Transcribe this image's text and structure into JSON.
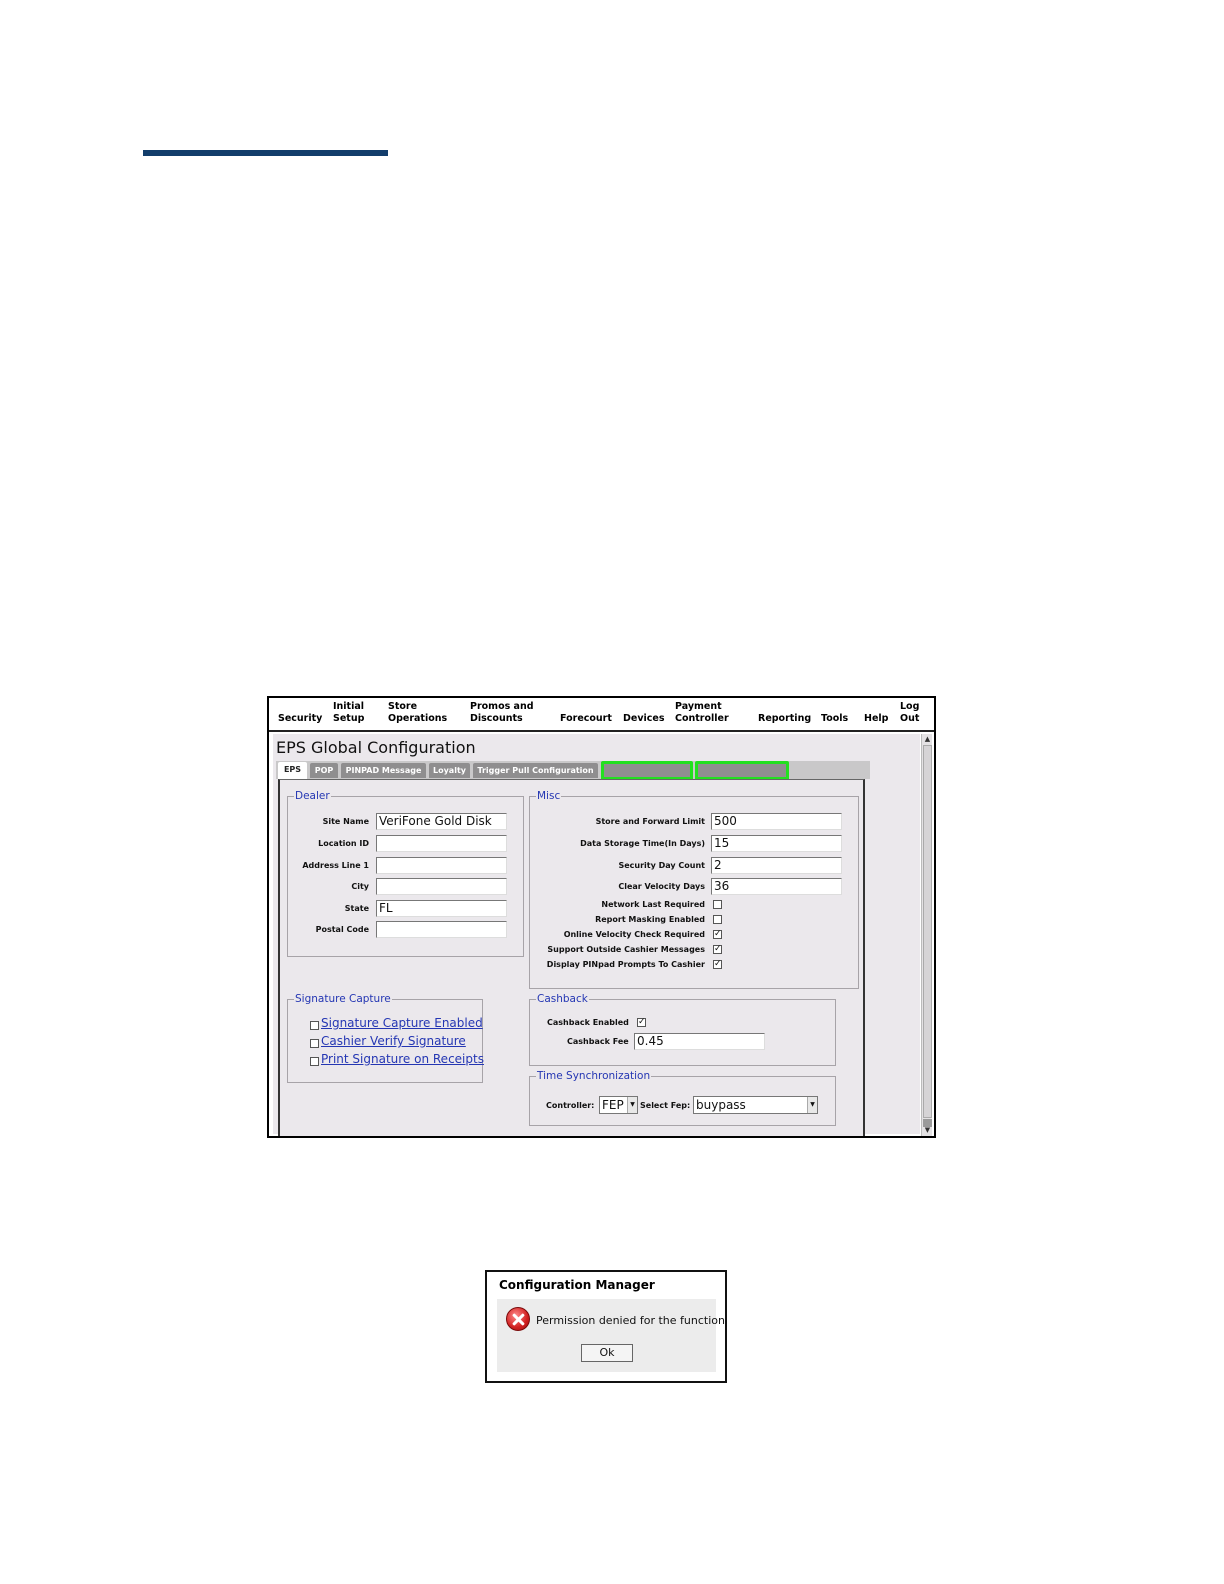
{
  "menu": [
    {
      "label": "Security"
    },
    {
      "label": "Initial\nSetup"
    },
    {
      "label": "Store\nOperations"
    },
    {
      "label": "Promos and\nDiscounts"
    },
    {
      "label": "Forecourt"
    },
    {
      "label": "Devices"
    },
    {
      "label": "Payment\nController"
    },
    {
      "label": "Reporting"
    },
    {
      "label": "Tools"
    },
    {
      "label": "Help"
    },
    {
      "label": "Log\nOut"
    }
  ],
  "page_title": "EPS Global Configuration",
  "tabs": [
    {
      "label": "EPS",
      "active": true
    },
    {
      "label": "POP"
    },
    {
      "label": "PINPAD Message"
    },
    {
      "label": "Loyalty"
    },
    {
      "label": "Trigger Pull Configuration"
    },
    {
      "label": "",
      "highlighted": true
    },
    {
      "label": "",
      "highlighted": true
    }
  ],
  "highlight_color": "#22e01f",
  "dealer": {
    "legend": "Dealer",
    "fields": [
      {
        "label": "Site Name",
        "value": "VeriFone Gold Disk"
      },
      {
        "label": "Location ID",
        "value": ""
      },
      {
        "label": "Address Line 1",
        "value": ""
      },
      {
        "label": "City",
        "value": ""
      },
      {
        "label": "State",
        "value": "FL"
      },
      {
        "label": "Postal Code",
        "value": ""
      }
    ]
  },
  "misc": {
    "legend": "Misc",
    "fields": [
      {
        "label": "Store and Forward Limit",
        "value": "500"
      },
      {
        "label": "Data Storage Time(In Days)",
        "value": "15"
      },
      {
        "label": "Security Day Count",
        "value": "2"
      },
      {
        "label": "Clear Velocity Days",
        "value": "36"
      }
    ],
    "checkboxes": [
      {
        "label": "Network Last Required",
        "checked": false,
        "mark": ""
      },
      {
        "label": "Report Masking Enabled",
        "checked": false,
        "mark": ""
      },
      {
        "label": "Online Velocity Check Required",
        "checked": true,
        "mark": "✓"
      },
      {
        "label": "Support Outside Cashier Messages",
        "checked": true,
        "mark": "✓"
      },
      {
        "label": "Display PINpad Prompts To Cashier",
        "checked": true,
        "mark": "✓"
      }
    ]
  },
  "signature": {
    "legend": "Signature Capture",
    "options": [
      {
        "label": "Signature Capture Enabled",
        "checked": false
      },
      {
        "label": "Cashier Verify Signature",
        "checked": false
      },
      {
        "label": "Print Signature on Receipts",
        "checked": false
      }
    ]
  },
  "cashback": {
    "legend": "Cashback",
    "enabled_label": "Cashback Enabled",
    "enabled_mark": "✓",
    "fee_label": "Cashback Fee",
    "fee_value": "0.45"
  },
  "time_sync": {
    "legend": "Time Synchronization",
    "controller_label": "Controller:",
    "controller_value": "FEP",
    "fep_label": "Select Fep:",
    "fep_value": "buypass"
  },
  "dialog": {
    "title": "Configuration Manager",
    "message": "Permission denied for the function",
    "ok_label": "Ok"
  }
}
